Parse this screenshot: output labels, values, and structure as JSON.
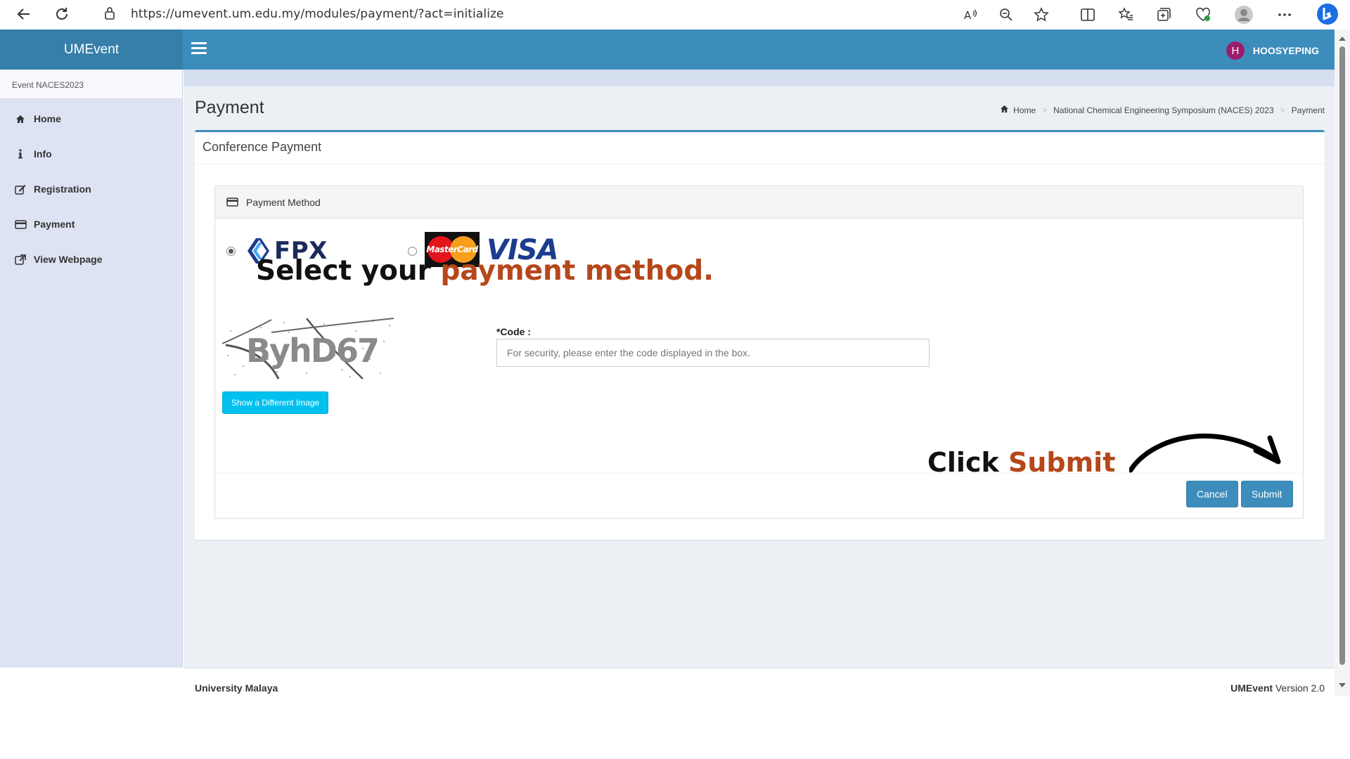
{
  "browser": {
    "url": "https://umevent.um.edu.my/modules/payment/?act=initialize"
  },
  "header": {
    "app_name": "UMEvent",
    "avatar_initial": "H",
    "username": "HOOSYEPING"
  },
  "sidebar": {
    "event_label": "Event NACES2023",
    "items": [
      {
        "label": "Home",
        "icon": "home-icon"
      },
      {
        "label": "Info",
        "icon": "info-icon"
      },
      {
        "label": "Registration",
        "icon": "edit-icon"
      },
      {
        "label": "Payment",
        "icon": "credit-card-icon"
      },
      {
        "label": "View Webpage",
        "icon": "external-link-icon"
      }
    ]
  },
  "page": {
    "title": "Payment",
    "breadcrumb": [
      "Home",
      "National Chemical Engineering Symposium (NACES) 2023",
      "Payment"
    ]
  },
  "box": {
    "title": "Conference Payment",
    "panel_title": "Payment Method",
    "options": {
      "fpx_label": "FPX",
      "mastercard_label": "MasterCard",
      "visa_label": "VISA"
    },
    "captcha_text": "ByhD67",
    "code_label": "*Code :",
    "code_placeholder": "For security, please enter the code displayed in the box.",
    "show_different_image": "Show a Different Image",
    "cancel": "Cancel",
    "submit": "Submit"
  },
  "overlays": {
    "select_prefix": "Select your ",
    "select_accent": "payment method.",
    "click_prefix": "Click ",
    "click_accent": "Submit"
  },
  "footer": {
    "left": "University Malaya",
    "brand": "UMEvent",
    "version": " Version 2.0"
  },
  "colors": {
    "header": "#3c8dbc",
    "sidebar": "#dde3f3",
    "accent": "#b5471a",
    "info_button": "#00c0ef"
  }
}
